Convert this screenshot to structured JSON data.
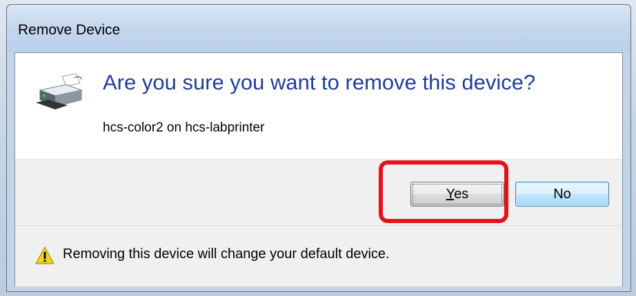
{
  "dialog": {
    "title": "Remove Device",
    "question": "Are you sure you want to remove this device?",
    "device_name": "hcs-color2 on hcs-labprinter",
    "yes_label_underlined": "Y",
    "yes_label_rest": "es",
    "no_label": "No",
    "warning": "Removing this device will change your default device."
  },
  "icons": {
    "device": "printer-icon",
    "warning": "warning-icon"
  },
  "colors": {
    "question_text": "#1e3e9a",
    "highlight": "#e8111a",
    "default_button_border": "#3c7fb1"
  }
}
